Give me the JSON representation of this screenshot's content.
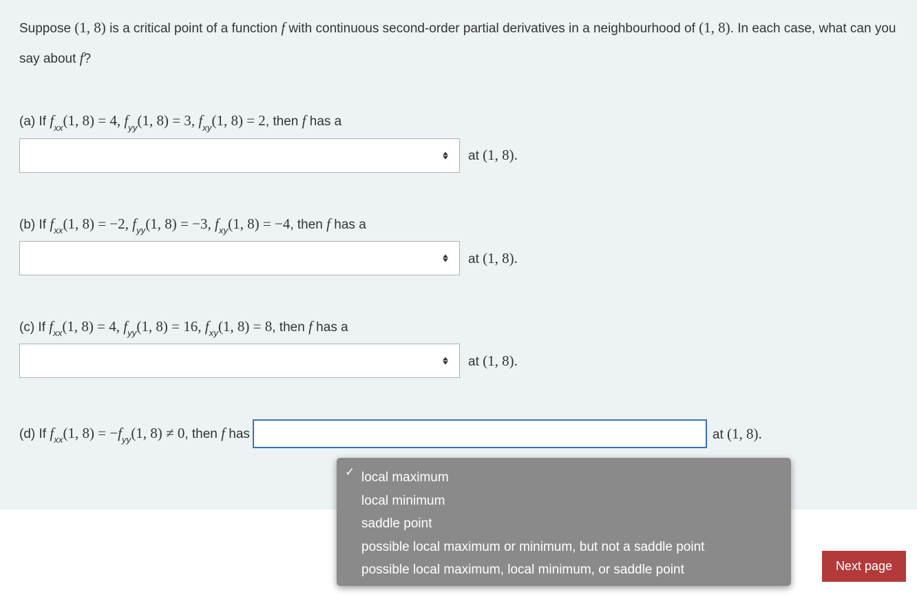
{
  "intro": {
    "pre": "Suppose ",
    "point": "(1, 8)",
    "mid1": " is a critical point of a function ",
    "fsym": "f",
    "mid2": " with continuous second-order partial derivatives in a neighbourhood of ",
    "point2": "(1, 8)",
    "mid3": ". In each case, what can you say about ",
    "end": "?"
  },
  "parts": {
    "a": {
      "label": "(a) If ",
      "fxx": "(1, 8) = 4",
      "fyy": "(1, 8) = 3",
      "fxy": "(1, 8) = 2",
      "then": ", then ",
      "hasA": " has a",
      "suffix_at": "at ",
      "suffix_point": "(1, 8)",
      "suffix_dot": "."
    },
    "b": {
      "label": "(b)  If ",
      "fxx": "(1, 8) = −2",
      "fyy": "(1, 8) = −3",
      "fxy": "(1, 8) = −4",
      "then": ", then ",
      "hasA": " has a",
      "suffix_at": "at ",
      "suffix_point": "(1, 8)",
      "suffix_dot": "."
    },
    "c": {
      "label": "(c)  If ",
      "fxx": "(1, 8) = 4",
      "fyy": "(1, 8) = 16",
      "fxy": "(1, 8) = 8",
      "then": ", then ",
      "hasA": " has a",
      "suffix_at": "at ",
      "suffix_point": "(1, 8)",
      "suffix_dot": "."
    },
    "d": {
      "label": "(d)  If ",
      "fxx_eq": "(1, 8) = −",
      "fyy_neq": "(1, 8) ≠ 0",
      "then": ", then ",
      "hasText": " has",
      "suffix_at": "at ",
      "suffix_point": "(1, 8)",
      "suffix_dot": "."
    }
  },
  "symbols": {
    "f": "f",
    "fxx": "xx",
    "fyy": "yy",
    "fxy": "xy",
    "comma": ", "
  },
  "dropdown": {
    "opt1": "local maximum",
    "opt2": "local minimum",
    "opt3": "saddle point",
    "opt4": "possible local maximum or minimum, but not a saddle point",
    "opt5": "possible local maximum, local minimum, or saddle point"
  },
  "next_button": "Next page"
}
